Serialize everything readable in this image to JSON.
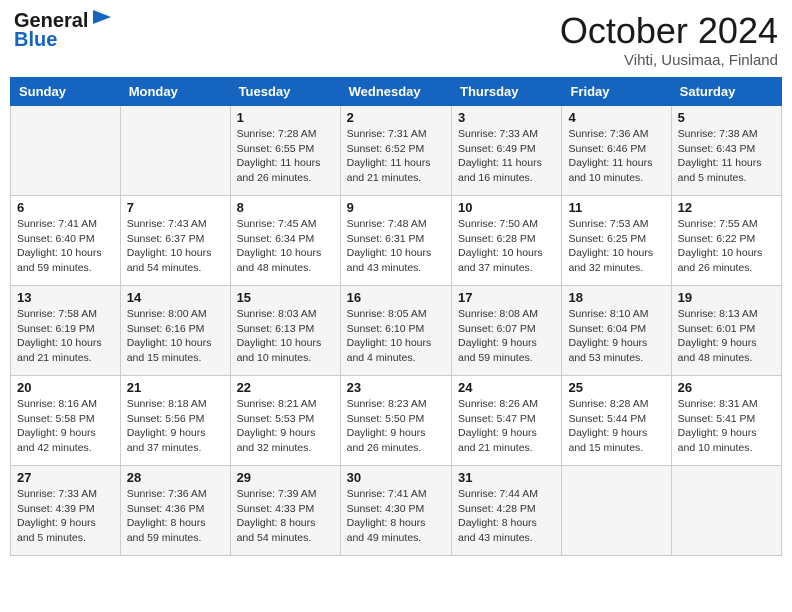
{
  "header": {
    "logo_line1": "General",
    "logo_line2": "Blue",
    "month": "October 2024",
    "location": "Vihti, Uusimaa, Finland"
  },
  "days_of_week": [
    "Sunday",
    "Monday",
    "Tuesday",
    "Wednesday",
    "Thursday",
    "Friday",
    "Saturday"
  ],
  "weeks": [
    [
      {
        "day": "",
        "content": ""
      },
      {
        "day": "",
        "content": ""
      },
      {
        "day": "1",
        "content": "Sunrise: 7:28 AM\nSunset: 6:55 PM\nDaylight: 11 hours and 26 minutes."
      },
      {
        "day": "2",
        "content": "Sunrise: 7:31 AM\nSunset: 6:52 PM\nDaylight: 11 hours and 21 minutes."
      },
      {
        "day": "3",
        "content": "Sunrise: 7:33 AM\nSunset: 6:49 PM\nDaylight: 11 hours and 16 minutes."
      },
      {
        "day": "4",
        "content": "Sunrise: 7:36 AM\nSunset: 6:46 PM\nDaylight: 11 hours and 10 minutes."
      },
      {
        "day": "5",
        "content": "Sunrise: 7:38 AM\nSunset: 6:43 PM\nDaylight: 11 hours and 5 minutes."
      }
    ],
    [
      {
        "day": "6",
        "content": "Sunrise: 7:41 AM\nSunset: 6:40 PM\nDaylight: 10 hours and 59 minutes."
      },
      {
        "day": "7",
        "content": "Sunrise: 7:43 AM\nSunset: 6:37 PM\nDaylight: 10 hours and 54 minutes."
      },
      {
        "day": "8",
        "content": "Sunrise: 7:45 AM\nSunset: 6:34 PM\nDaylight: 10 hours and 48 minutes."
      },
      {
        "day": "9",
        "content": "Sunrise: 7:48 AM\nSunset: 6:31 PM\nDaylight: 10 hours and 43 minutes."
      },
      {
        "day": "10",
        "content": "Sunrise: 7:50 AM\nSunset: 6:28 PM\nDaylight: 10 hours and 37 minutes."
      },
      {
        "day": "11",
        "content": "Sunrise: 7:53 AM\nSunset: 6:25 PM\nDaylight: 10 hours and 32 minutes."
      },
      {
        "day": "12",
        "content": "Sunrise: 7:55 AM\nSunset: 6:22 PM\nDaylight: 10 hours and 26 minutes."
      }
    ],
    [
      {
        "day": "13",
        "content": "Sunrise: 7:58 AM\nSunset: 6:19 PM\nDaylight: 10 hours and 21 minutes."
      },
      {
        "day": "14",
        "content": "Sunrise: 8:00 AM\nSunset: 6:16 PM\nDaylight: 10 hours and 15 minutes."
      },
      {
        "day": "15",
        "content": "Sunrise: 8:03 AM\nSunset: 6:13 PM\nDaylight: 10 hours and 10 minutes."
      },
      {
        "day": "16",
        "content": "Sunrise: 8:05 AM\nSunset: 6:10 PM\nDaylight: 10 hours and 4 minutes."
      },
      {
        "day": "17",
        "content": "Sunrise: 8:08 AM\nSunset: 6:07 PM\nDaylight: 9 hours and 59 minutes."
      },
      {
        "day": "18",
        "content": "Sunrise: 8:10 AM\nSunset: 6:04 PM\nDaylight: 9 hours and 53 minutes."
      },
      {
        "day": "19",
        "content": "Sunrise: 8:13 AM\nSunset: 6:01 PM\nDaylight: 9 hours and 48 minutes."
      }
    ],
    [
      {
        "day": "20",
        "content": "Sunrise: 8:16 AM\nSunset: 5:58 PM\nDaylight: 9 hours and 42 minutes."
      },
      {
        "day": "21",
        "content": "Sunrise: 8:18 AM\nSunset: 5:56 PM\nDaylight: 9 hours and 37 minutes."
      },
      {
        "day": "22",
        "content": "Sunrise: 8:21 AM\nSunset: 5:53 PM\nDaylight: 9 hours and 32 minutes."
      },
      {
        "day": "23",
        "content": "Sunrise: 8:23 AM\nSunset: 5:50 PM\nDaylight: 9 hours and 26 minutes."
      },
      {
        "day": "24",
        "content": "Sunrise: 8:26 AM\nSunset: 5:47 PM\nDaylight: 9 hours and 21 minutes."
      },
      {
        "day": "25",
        "content": "Sunrise: 8:28 AM\nSunset: 5:44 PM\nDaylight: 9 hours and 15 minutes."
      },
      {
        "day": "26",
        "content": "Sunrise: 8:31 AM\nSunset: 5:41 PM\nDaylight: 9 hours and 10 minutes."
      }
    ],
    [
      {
        "day": "27",
        "content": "Sunrise: 7:33 AM\nSunset: 4:39 PM\nDaylight: 9 hours and 5 minutes."
      },
      {
        "day": "28",
        "content": "Sunrise: 7:36 AM\nSunset: 4:36 PM\nDaylight: 8 hours and 59 minutes."
      },
      {
        "day": "29",
        "content": "Sunrise: 7:39 AM\nSunset: 4:33 PM\nDaylight: 8 hours and 54 minutes."
      },
      {
        "day": "30",
        "content": "Sunrise: 7:41 AM\nSunset: 4:30 PM\nDaylight: 8 hours and 49 minutes."
      },
      {
        "day": "31",
        "content": "Sunrise: 7:44 AM\nSunset: 4:28 PM\nDaylight: 8 hours and 43 minutes."
      },
      {
        "day": "",
        "content": ""
      },
      {
        "day": "",
        "content": ""
      }
    ]
  ]
}
